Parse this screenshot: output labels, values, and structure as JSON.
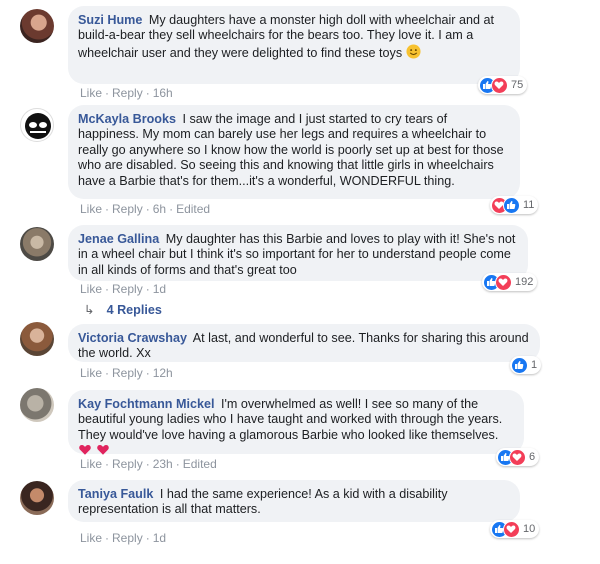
{
  "comments": [
    {
      "author": "Suzi Hume",
      "text": "My daughters have a monster high doll with wheelchair and at build-a-bear they sell wheelchairs for the bears too. They love it. I am a wheelchair user and they were delighted to find these toys",
      "actions": {
        "like": "Like",
        "reply": "Reply",
        "time": "16h",
        "edited": ""
      },
      "reactions": {
        "count": "75"
      }
    },
    {
      "author": "McKayla Brooks",
      "text": "I saw the image and I just started to cry tears of happiness. My mom can barely use her legs and requires a wheelchair to really go anywhere so I know how the world is poorly set up at best for those who are disabled. So seeing this and knowing that little girls in wheelchairs have a Barbie that's for them...it's a wonderful, WONDERFUL thing.",
      "actions": {
        "like": "Like",
        "reply": "Reply",
        "time": "6h",
        "edited": "Edited"
      },
      "reactions": {
        "count": "11"
      }
    },
    {
      "author": "Jenae Gallina",
      "text": "My daughter has this Barbie and loves to play with it! She's not in a wheel chair but I think it's so important for her to understand people come in all kinds of forms and that's great too",
      "actions": {
        "like": "Like",
        "reply": "Reply",
        "time": "1d",
        "edited": ""
      },
      "reactions": {
        "count": "192"
      },
      "replies": "4 Replies"
    },
    {
      "author": "Victoria Crawshay",
      "text": "At last, and wonderful to see. Thanks for sharing this around the world. Xx",
      "actions": {
        "like": "Like",
        "reply": "Reply",
        "time": "12h",
        "edited": ""
      },
      "reactions": {
        "count": "1"
      }
    },
    {
      "author": "Kay Fochtmann Mickel",
      "text": "I'm overwhelmed as well! I see so many of the beautiful young ladies who I have taught and worked with through the years. They would've love having a glamorous Barbie who looked like themselves.",
      "actions": {
        "like": "Like",
        "reply": "Reply",
        "time": "23h",
        "edited": "Edited"
      },
      "reactions": {
        "count": "6"
      }
    },
    {
      "author": "Taniya Faulk",
      "text": "I had the same experience! As a kid with a disability representation is all that matters.",
      "actions": {
        "like": "Like",
        "reply": "Reply",
        "time": "1d",
        "edited": ""
      },
      "reactions": {
        "count": "10"
      }
    }
  ],
  "icons": {
    "like": "like-reaction-icon",
    "love": "love-reaction-icon",
    "reply_arrow": "reply-arrow-icon",
    "smile_emoji": "smiling-emoji",
    "heart_emoji": "heart-emoji"
  },
  "colors": {
    "author": "#385898",
    "bubble": "#f0f2f5",
    "meta": "#8d949e",
    "like": "#1877f2",
    "love": "#f33e58"
  }
}
